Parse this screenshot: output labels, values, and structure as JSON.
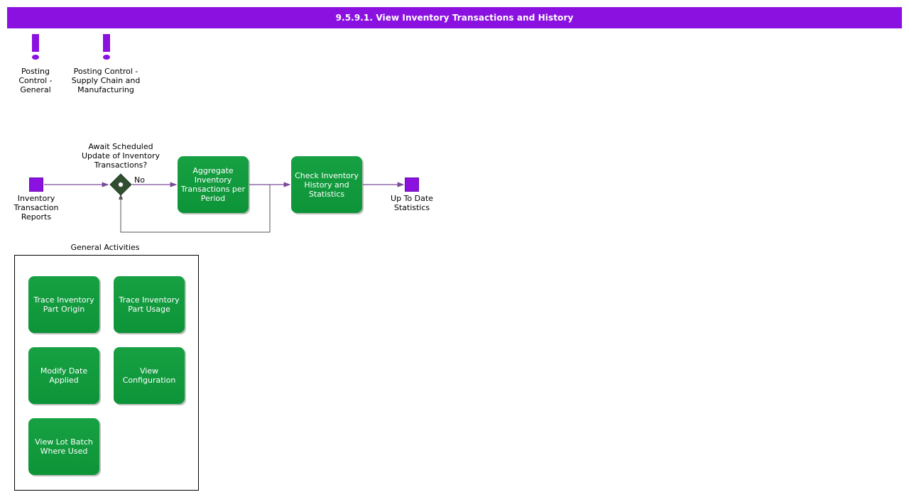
{
  "title_bar": {
    "title": "9.5.9.1. View Inventory Transactions and History"
  },
  "notes": [
    {
      "icon": "exclamation-icon",
      "label": "Posting\nControl -\nGeneral"
    },
    {
      "icon": "exclamation-icon",
      "label": "Posting Control -\nSupply Chain and\nManufacturing"
    }
  ],
  "flow": {
    "start_event": {
      "icon": "purple-square-icon",
      "label": "Inventory\nTransaction\nReports"
    },
    "decision": {
      "icon": "decision-diamond-icon",
      "label": "Await Scheduled\nUpdate of Inventory\nTransactions?",
      "branch_label": "No"
    },
    "activities": [
      {
        "label": "Aggregate\nInventory\nTransactions per\nPeriod"
      },
      {
        "label": "Check Inventory\nHistory and\nStatistics"
      }
    ],
    "end_event": {
      "icon": "purple-square-icon",
      "label": "Up To Date\nStatistics"
    }
  },
  "general_activities": {
    "label": "General Activities",
    "items": [
      {
        "label": "Trace Inventory\nPart Origin"
      },
      {
        "label": "Trace Inventory\nPart Usage"
      },
      {
        "label": "Modify Date\nApplied"
      },
      {
        "label": "View\nConfiguration"
      },
      {
        "label": "View Lot Batch\nWhere Used"
      }
    ]
  },
  "colors": {
    "title_bar": "#8A11DF",
    "event": "#8A11DF",
    "activity": "#15A03F",
    "connector": "#7a4a9a"
  }
}
